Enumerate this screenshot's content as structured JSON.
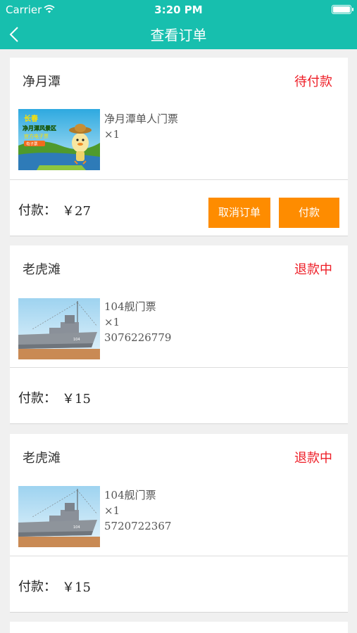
{
  "status_bar": {
    "carrier": "Carrier",
    "time": "3:20 PM"
  },
  "nav": {
    "title": "查看订单",
    "back_icon": "chevron-left-icon"
  },
  "colors": {
    "header": "#17bfae",
    "status_red": "#ee1c25",
    "button_orange": "#fe8c00"
  },
  "orders": [
    {
      "place": "净月潭",
      "status": "待付款",
      "item_name": "净月潭单人门票",
      "quantity": "×1",
      "pay_label": "付款：",
      "amount": "￥27",
      "cancel_label": "取消订单",
      "pay_button_label": "付款",
      "thumbnail": {
        "kind": "promo poster",
        "lines": [
          "长春",
          "净月潭风景区",
          "官方电子票"
        ],
        "badge": "电子票"
      }
    },
    {
      "place": "老虎滩",
      "status": "退款中",
      "item_name": "104舰门票",
      "quantity": "×1",
      "order_number": "3076226779",
      "pay_label": "付款：",
      "amount": "￥15",
      "thumbnail": {
        "kind": "warship photo",
        "hull_number": "104"
      }
    },
    {
      "place": "老虎滩",
      "status": "退款中",
      "item_name": "104舰门票",
      "quantity": "×1",
      "order_number": "5720722367",
      "pay_label": "付款：",
      "amount": "￥15",
      "thumbnail": {
        "kind": "warship photo",
        "hull_number": "104"
      }
    }
  ]
}
